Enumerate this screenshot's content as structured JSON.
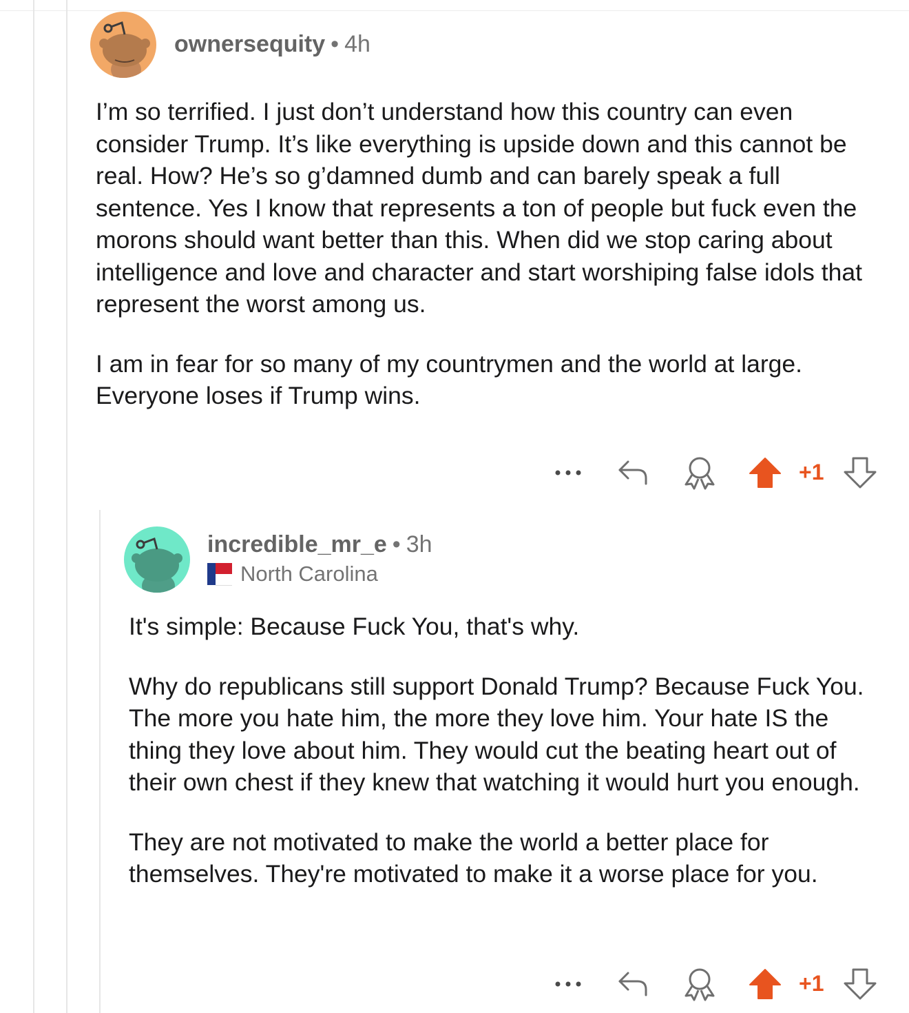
{
  "comments": [
    {
      "username": "ownersequity",
      "separator": "•",
      "age": "4h",
      "avatar_color": "#f2a866",
      "paragraphs": [
        "I’m so terrified. I just don’t understand how this country can even consider Trump. It’s like everything is upside down and this cannot be real. How? He’s so g’damned dumb and can barely speak a full sentence. Yes I know that represents a ton of people but fuck even the morons should want better than this. When did we stop caring about intelligence and love and character and start worshiping false idols that represent the worst among us.",
        "I am in fear for so many of my countrymen and the world at large. Everyone loses if Trump wins."
      ],
      "actions": {
        "more_icon": "ellipsis-icon",
        "reply_icon": "reply-icon",
        "award_icon": "award-icon",
        "upvote_icon": "upvote-icon",
        "downvote_icon": "downvote-icon"
      },
      "score": "+1"
    },
    {
      "username": "incredible_mr_e",
      "separator": "•",
      "age": "3h",
      "flair": "North Carolina",
      "avatar_color": "#6fe8c8",
      "paragraphs": [
        "It's simple: Because Fuck You, that's why.",
        "Why do republicans still support Donald Trump? Because Fuck You. The more you hate him, the more they love him. Your hate IS the thing they love about him. They would cut the beating heart out of their own chest if they knew that watching it would hurt you enough.",
        "They are not motivated to make the world a better place for themselves. They're motivated to make it a worse place for you."
      ],
      "actions": {
        "more_icon": "ellipsis-icon",
        "reply_icon": "reply-icon",
        "award_icon": "award-icon",
        "upvote_icon": "upvote-icon",
        "downvote_icon": "downvote-icon"
      },
      "score": "+1"
    }
  ],
  "colors": {
    "upvote_active": "#e8541f",
    "icon_gray": "#6f6f6f",
    "thread_line": "#e6e6e6"
  }
}
